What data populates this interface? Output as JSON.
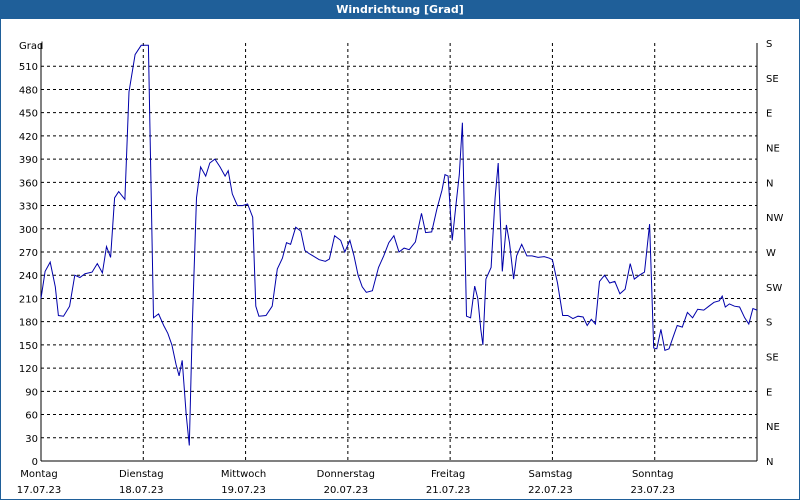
{
  "title": "Windrichtung [Grad]",
  "colors": {
    "header": "#1f5f99",
    "series": "#0000aa",
    "grid": "#000000"
  },
  "chart_data": {
    "type": "line",
    "title": "Windrichtung [Grad]",
    "ylabel": "Grad",
    "ylim": [
      0,
      540
    ],
    "yticks": [
      0,
      30,
      60,
      90,
      120,
      150,
      180,
      210,
      240,
      270,
      300,
      330,
      360,
      390,
      420,
      450,
      480,
      510
    ],
    "right_ticks": [
      {
        "value": 0,
        "label": "N"
      },
      {
        "value": 45,
        "label": "NE"
      },
      {
        "value": 90,
        "label": "E"
      },
      {
        "value": 135,
        "label": "SE"
      },
      {
        "value": 180,
        "label": "S"
      },
      {
        "value": 225,
        "label": "SW"
      },
      {
        "value": 270,
        "label": "W"
      },
      {
        "value": 315,
        "label": "NW"
      },
      {
        "value": 360,
        "label": "N"
      },
      {
        "value": 405,
        "label": "NE"
      },
      {
        "value": 450,
        "label": "E"
      },
      {
        "value": 495,
        "label": "SE"
      },
      {
        "value": 540,
        "label": "S"
      }
    ],
    "xlim": [
      0,
      7
    ],
    "xticks": [
      {
        "day": "Montag",
        "date": "17.07.23"
      },
      {
        "day": "Dienstag",
        "date": "18.07.23"
      },
      {
        "day": "Mittwoch",
        "date": "19.07.23"
      },
      {
        "day": "Donnerstag",
        "date": "20.07.23"
      },
      {
        "day": "Freitag",
        "date": "21.07.23"
      },
      {
        "day": "Samstag",
        "date": "22.07.23"
      },
      {
        "day": "Sonntag",
        "date": "23.07.23"
      }
    ],
    "grid": true,
    "series": [
      {
        "values": [
          [
            0.0,
            210
          ],
          [
            0.04,
            245
          ],
          [
            0.09,
            257
          ],
          [
            0.14,
            225
          ],
          [
            0.17,
            188
          ],
          [
            0.22,
            187
          ],
          [
            0.28,
            200
          ],
          [
            0.33,
            240
          ],
          [
            0.38,
            237
          ],
          [
            0.43,
            242
          ],
          [
            0.5,
            244
          ],
          [
            0.55,
            255
          ],
          [
            0.6,
            243
          ],
          [
            0.64,
            277
          ],
          [
            0.68,
            263
          ],
          [
            0.72,
            340
          ],
          [
            0.76,
            348
          ],
          [
            0.82,
            338
          ],
          [
            0.86,
            477
          ],
          [
            0.92,
            525
          ],
          [
            0.98,
            537
          ],
          [
            1.05,
            537
          ],
          [
            1.1,
            185
          ],
          [
            1.15,
            190
          ],
          [
            1.2,
            175
          ],
          [
            1.24,
            165
          ],
          [
            1.28,
            150
          ],
          [
            1.32,
            125
          ],
          [
            1.35,
            110
          ],
          [
            1.38,
            130
          ],
          [
            1.42,
            60
          ],
          [
            1.45,
            20
          ],
          [
            1.48,
            180
          ],
          [
            1.52,
            340
          ],
          [
            1.56,
            380
          ],
          [
            1.61,
            368
          ],
          [
            1.65,
            385
          ],
          [
            1.7,
            390
          ],
          [
            1.75,
            380
          ],
          [
            1.8,
            368
          ],
          [
            1.83,
            375
          ],
          [
            1.87,
            345
          ],
          [
            1.92,
            330
          ],
          [
            1.97,
            330
          ],
          [
            2.02,
            332
          ],
          [
            2.07,
            315
          ],
          [
            2.1,
            200
          ],
          [
            2.13,
            187
          ],
          [
            2.2,
            188
          ],
          [
            2.26,
            200
          ],
          [
            2.31,
            248
          ],
          [
            2.36,
            262
          ],
          [
            2.4,
            282
          ],
          [
            2.44,
            280
          ],
          [
            2.49,
            302
          ],
          [
            2.54,
            297
          ],
          [
            2.58,
            272
          ],
          [
            2.62,
            268
          ],
          [
            2.66,
            265
          ],
          [
            2.72,
            260
          ],
          [
            2.78,
            258
          ],
          [
            2.82,
            261
          ],
          [
            2.87,
            291
          ],
          [
            2.93,
            285
          ],
          [
            2.97,
            270
          ],
          [
            3.02,
            285
          ],
          [
            3.06,
            265
          ],
          [
            3.1,
            240
          ],
          [
            3.14,
            225
          ],
          [
            3.18,
            218
          ],
          [
            3.24,
            220
          ],
          [
            3.3,
            250
          ],
          [
            3.35,
            265
          ],
          [
            3.4,
            282
          ],
          [
            3.45,
            291
          ],
          [
            3.5,
            270
          ],
          [
            3.55,
            275
          ],
          [
            3.6,
            273
          ],
          [
            3.66,
            283
          ],
          [
            3.72,
            320
          ],
          [
            3.76,
            295
          ],
          [
            3.82,
            296
          ],
          [
            3.87,
            325
          ],
          [
            3.92,
            350
          ],
          [
            3.95,
            370
          ],
          [
            3.98,
            368
          ],
          [
            4.02,
            285
          ],
          [
            4.06,
            335
          ],
          [
            4.09,
            370
          ],
          [
            4.12,
            437
          ],
          [
            4.16,
            187
          ],
          [
            4.2,
            185
          ],
          [
            4.24,
            226
          ],
          [
            4.27,
            210
          ],
          [
            4.3,
            170
          ],
          [
            4.32,
            150
          ],
          [
            4.35,
            235
          ],
          [
            4.4,
            250
          ],
          [
            4.44,
            340
          ],
          [
            4.47,
            385
          ],
          [
            4.51,
            245
          ],
          [
            4.55,
            305
          ],
          [
            4.58,
            282
          ],
          [
            4.62,
            235
          ],
          [
            4.65,
            265
          ],
          [
            4.7,
            280
          ],
          [
            4.75,
            265
          ],
          [
            4.8,
            265
          ],
          [
            4.86,
            263
          ],
          [
            4.92,
            264
          ],
          [
            4.97,
            262
          ],
          [
            5.0,
            260
          ],
          [
            5.05,
            230
          ],
          [
            5.1,
            188
          ],
          [
            5.15,
            188
          ],
          [
            5.2,
            184
          ],
          [
            5.25,
            187
          ],
          [
            5.3,
            186
          ],
          [
            5.34,
            175
          ],
          [
            5.38,
            183
          ],
          [
            5.42,
            177
          ],
          [
            5.46,
            232
          ],
          [
            5.51,
            240
          ],
          [
            5.56,
            230
          ],
          [
            5.61,
            232
          ],
          [
            5.66,
            216
          ],
          [
            5.71,
            222
          ],
          [
            5.76,
            255
          ],
          [
            5.8,
            235
          ],
          [
            5.85,
            240
          ],
          [
            5.9,
            244
          ],
          [
            5.95,
            306
          ],
          [
            5.99,
            146
          ],
          [
            6.02,
            145
          ],
          [
            6.06,
            170
          ],
          [
            6.1,
            143
          ],
          [
            6.14,
            145
          ],
          [
            6.18,
            160
          ],
          [
            6.22,
            175
          ],
          [
            6.27,
            173
          ],
          [
            6.32,
            192
          ],
          [
            6.37,
            185
          ],
          [
            6.42,
            196
          ],
          [
            6.48,
            195
          ],
          [
            6.53,
            200
          ],
          [
            6.58,
            205
          ],
          [
            6.63,
            207
          ],
          [
            6.66,
            213
          ],
          [
            6.69,
            199
          ],
          [
            6.73,
            203
          ],
          [
            6.78,
            200
          ],
          [
            6.83,
            199
          ],
          [
            6.88,
            185
          ],
          [
            6.92,
            177
          ],
          [
            6.96,
            197
          ],
          [
            7.0,
            195
          ]
        ]
      }
    ]
  }
}
